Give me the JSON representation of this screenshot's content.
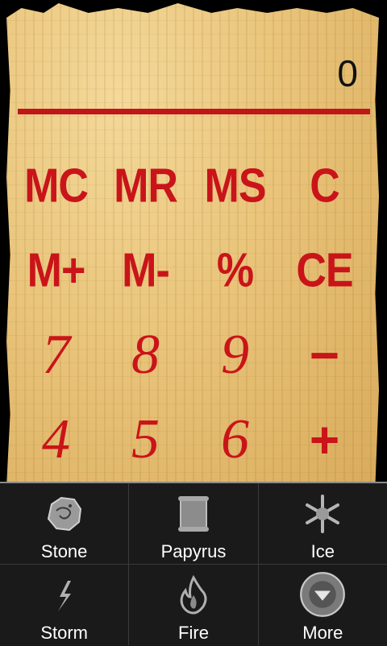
{
  "display": {
    "value": "0"
  },
  "keys": {
    "row1": [
      "MC",
      "MR",
      "MS",
      "C"
    ],
    "row2": [
      "M+",
      "M-",
      "%",
      "CE"
    ],
    "row3": [
      "7",
      "8",
      "9",
      "−"
    ],
    "row4": [
      "4",
      "5",
      "6",
      "+"
    ]
  },
  "menu": {
    "items": [
      {
        "label": "Stone",
        "icon": "stone-icon"
      },
      {
        "label": "Papyrus",
        "icon": "papyrus-icon"
      },
      {
        "label": "Ice",
        "icon": "snowflake-icon"
      },
      {
        "label": "Storm",
        "icon": "lightning-icon"
      },
      {
        "label": "Fire",
        "icon": "fire-icon"
      },
      {
        "label": "More",
        "icon": "more-icon"
      }
    ]
  },
  "colors": {
    "accent": "#c9141a",
    "menu_bg": "#1a1a1a"
  }
}
